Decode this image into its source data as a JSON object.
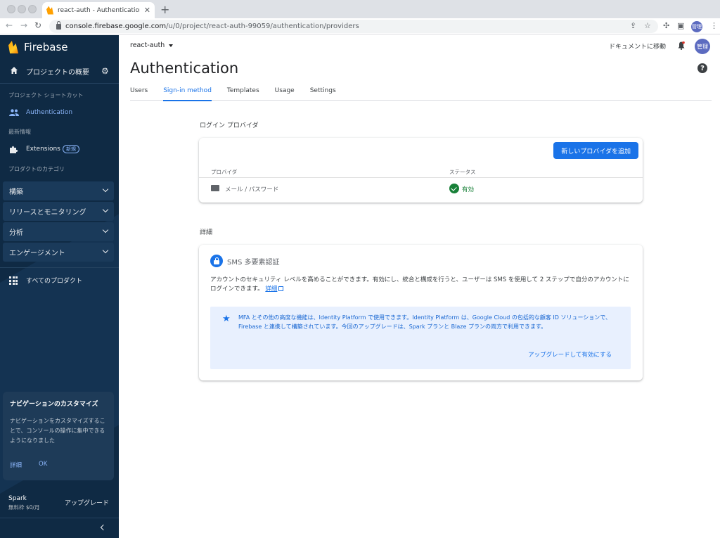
{
  "browser": {
    "tab_title": "react-auth - Authentication - F",
    "url_host": "console.firebase.google.com",
    "url_path": "/u/0/project/react-auth-99059/authentication/providers",
    "profile_label": "管理"
  },
  "sidebar": {
    "brand": "Firebase",
    "overview_label": "プロジェクトの概要",
    "shortcuts_section": "プロジェクト ショートカット",
    "auth_label": "Authentication",
    "news_section": "最新情報",
    "extensions_label": "Extensions",
    "new_badge": "新規",
    "categories_section": "プロダクトのカテゴリ",
    "categories": [
      {
        "label": "構築"
      },
      {
        "label": "リリースとモニタリング"
      },
      {
        "label": "分析"
      },
      {
        "label": "エンゲージメント"
      }
    ],
    "all_products": "すべてのプロダクト",
    "customize": {
      "title": "ナビゲーションのカスタマイズ",
      "body": "ナビゲーションをカスタマイズすることで、コンソールの操作に集中できるようになりました",
      "details": "詳細",
      "ok": "OK"
    },
    "plan": {
      "name": "Spark",
      "sub": "無料枠 $0/月",
      "upgrade": "アップグレード"
    }
  },
  "header": {
    "project": "react-auth",
    "docs_link": "ドキュメントに移動",
    "avatar": "管理",
    "title": "Authentication"
  },
  "tabs": [
    {
      "label": "Users"
    },
    {
      "label": "Sign-in method"
    },
    {
      "label": "Templates"
    },
    {
      "label": "Usage"
    },
    {
      "label": "Settings"
    }
  ],
  "providers": {
    "section_label": "ログイン プロバイダ",
    "add_button": "新しいプロバイダを追加",
    "col_provider": "プロバイダ",
    "col_status": "ステータス",
    "rows": [
      {
        "name": "メール / パスワード",
        "status": "有効"
      }
    ]
  },
  "details": {
    "section_label": "詳細",
    "sms_title": "SMS 多要素認証",
    "sms_desc": "アカウントのセキュリティ レベルを高めることができます。有効にし、統合と構成を行うと、ユーザーは SMS を使用して 2 ステップで自分のアカウントにログインできます。",
    "more_link": "詳細",
    "mfa_text": "MFA とその他の高度な機能は、Identity Platform で使用できます。Identity Platform は、Google Cloud の包括的な顧客 ID ソリューションで、Firebase と連携して構築されています。今回のアップグレードは、Spark プランと Blaze プランの両方で利用できます。",
    "upgrade_button": "アップグレードして有効にする"
  },
  "colors": {
    "sidebar_bg": "#0f2a44",
    "accent": "#1a73e8",
    "success": "#188038"
  }
}
